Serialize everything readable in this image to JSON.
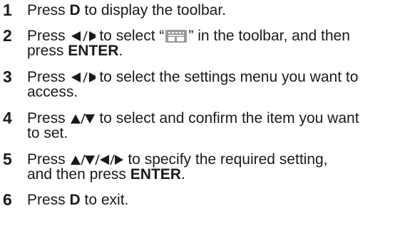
{
  "steps": [
    {
      "num": "1",
      "parts": [
        "Press ",
        "D",
        " to display the toolbar."
      ]
    },
    {
      "num": "2",
      "parts": [
        "Press ",
        " to select “",
        "” in the toolbar, and then",
        "press ",
        "ENTER",
        "."
      ]
    },
    {
      "num": "3",
      "parts": [
        "Press ",
        " to select the settings menu you want to",
        "access."
      ]
    },
    {
      "num": "4",
      "parts": [
        "Press ",
        " to select and confirm the item you want",
        "to set."
      ]
    },
    {
      "num": "5",
      "parts": [
        "Press ",
        " to specify the required setting,",
        "and then press ",
        "ENTER",
        "."
      ]
    },
    {
      "num": "6",
      "parts": [
        "Press ",
        "D",
        " to exit."
      ]
    }
  ],
  "icons": {
    "left_right": "left-right-arrow-icon",
    "up_down": "up-down-arrow-icon",
    "four_way": "four-way-arrow-icon",
    "settings_toolbar": "settings-toolbar-icon"
  },
  "colors": {
    "text": "#1a1a1a",
    "icon_fill": "#9a9a9a"
  }
}
